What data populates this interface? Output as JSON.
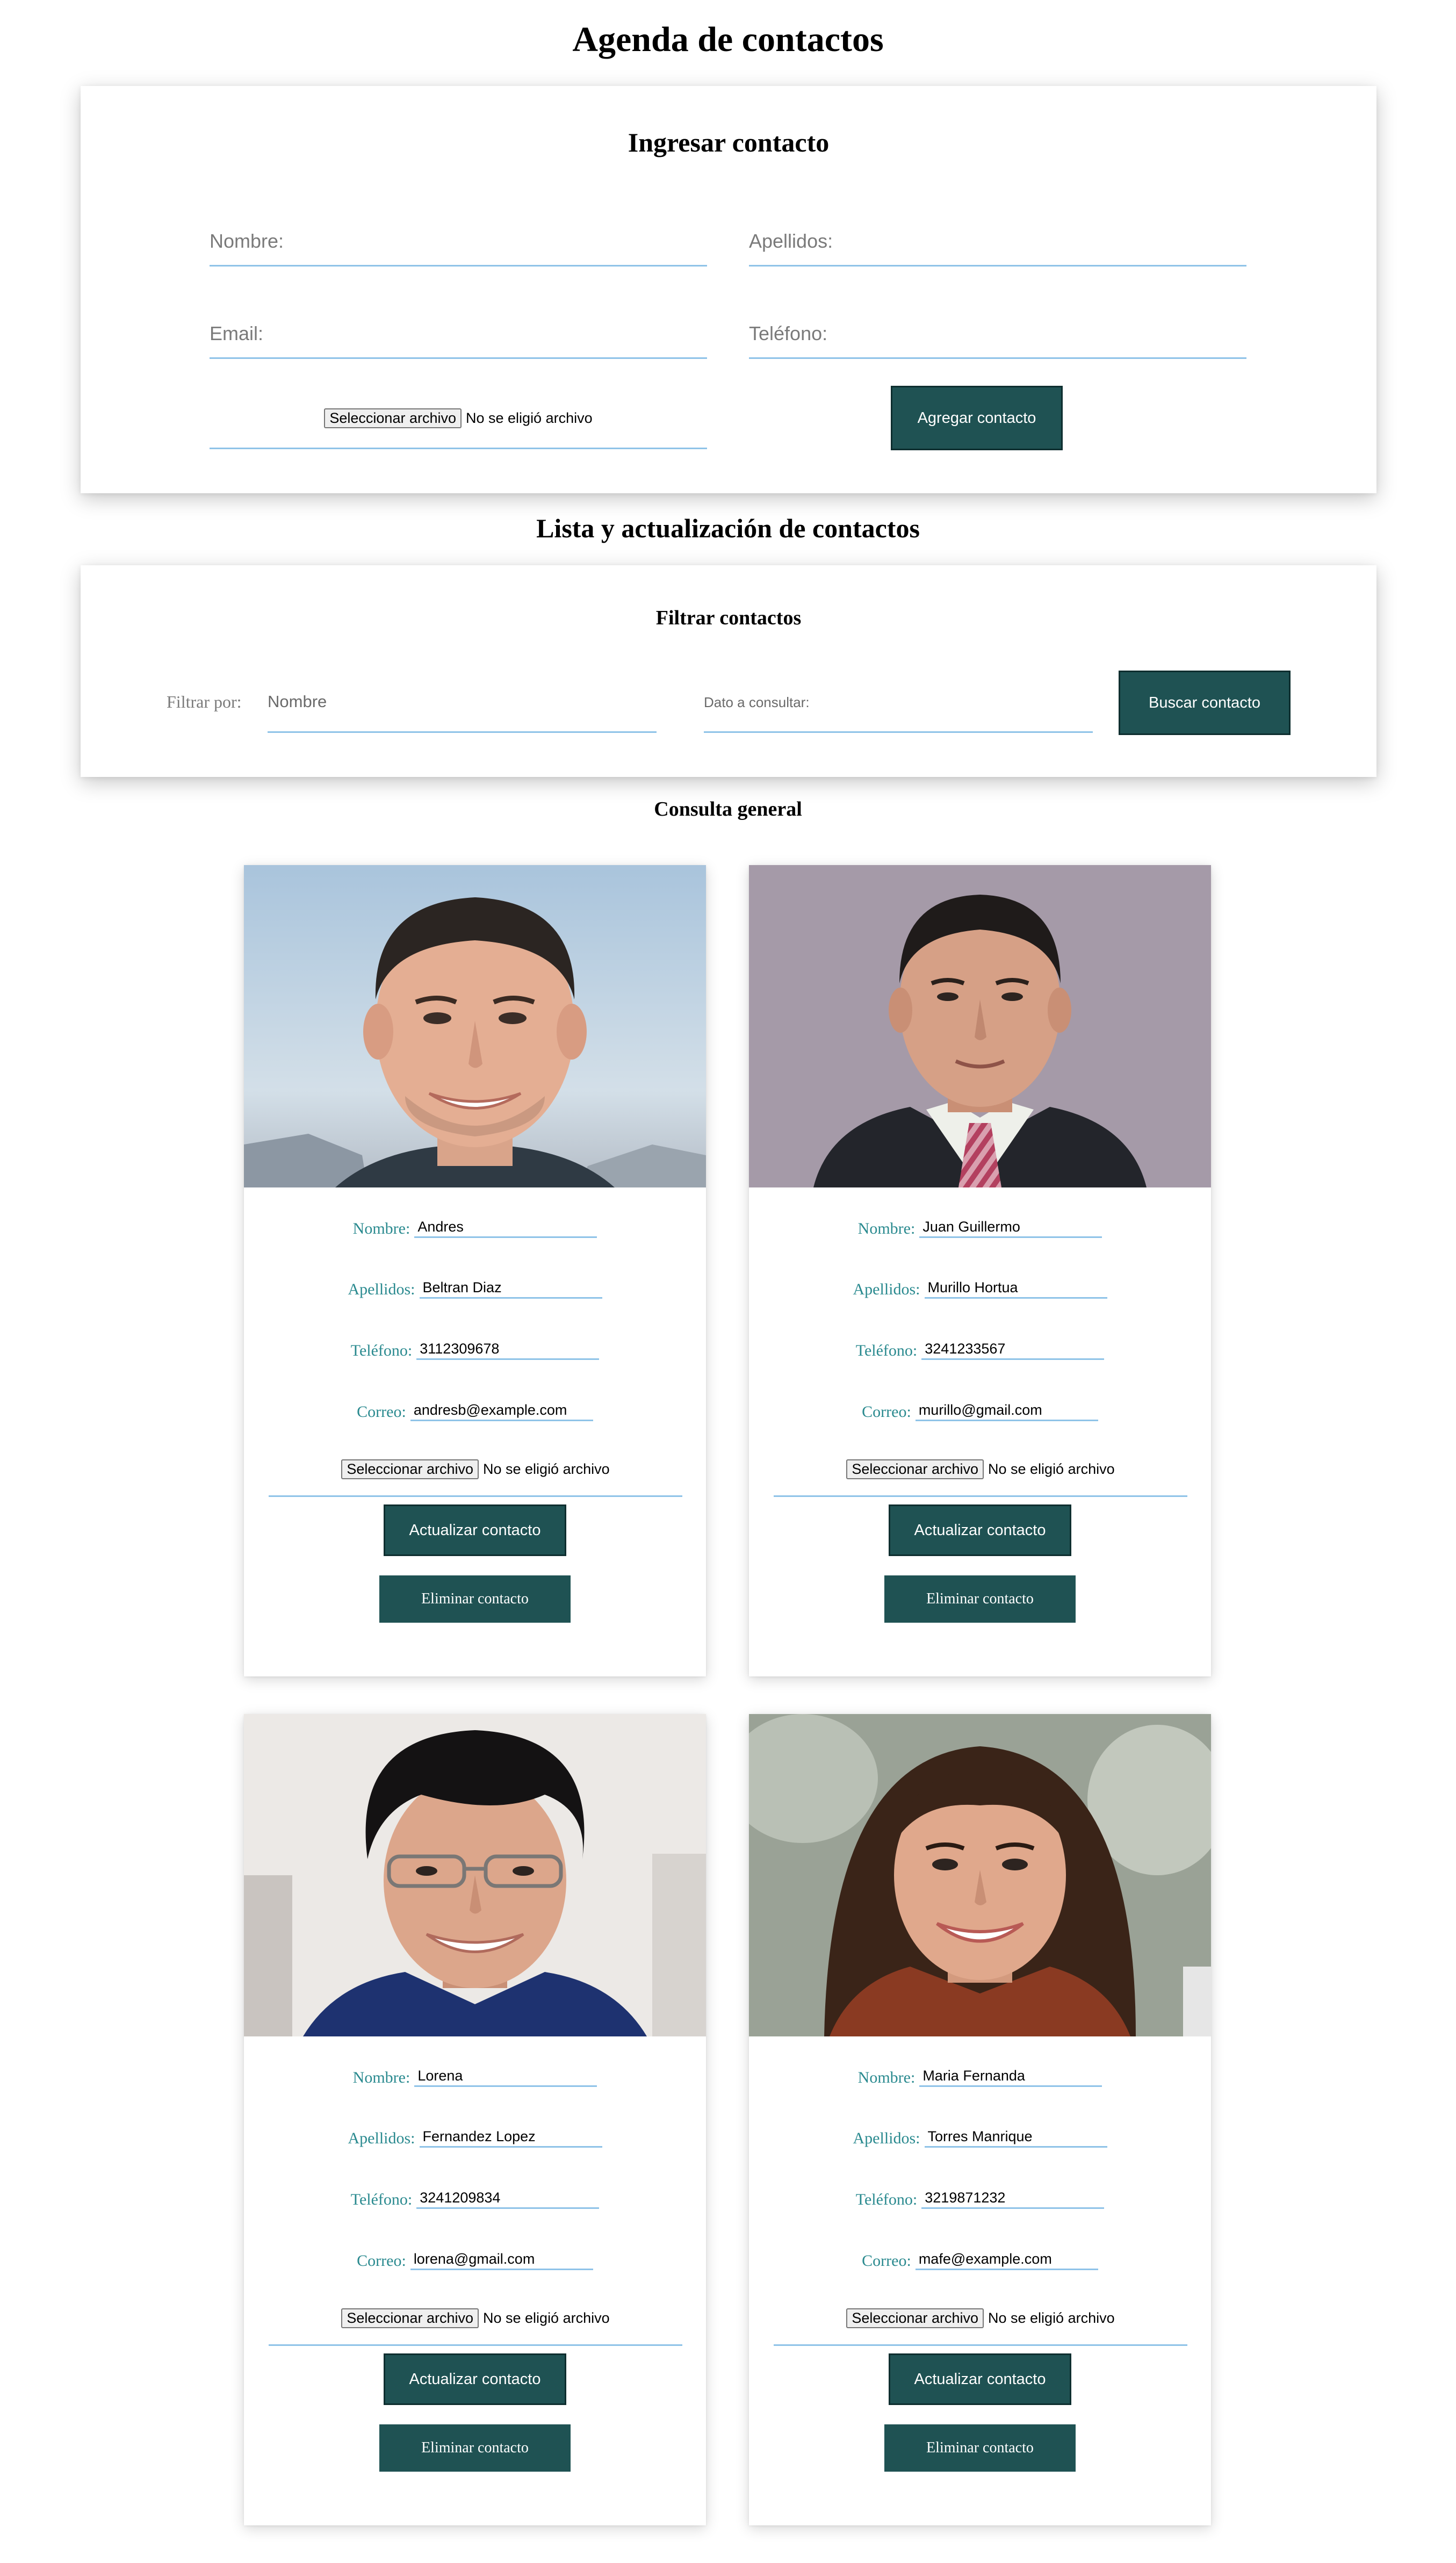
{
  "page": {
    "title": "Agenda de contactos"
  },
  "add_form": {
    "title": "Ingresar contacto",
    "nombre_placeholder": "Nombre:",
    "apellidos_placeholder": "Apellidos:",
    "email_placeholder": "Email:",
    "telefono_placeholder": "Teléfono:",
    "file_button": "Seleccionar archivo",
    "file_status": "No se eligió archivo",
    "submit_label": "Agregar contacto"
  },
  "list_section": {
    "title": "Lista y actualización de contactos"
  },
  "filter": {
    "title": "Filtrar contactos",
    "filter_by_label": "Filtrar por:",
    "selected_option": "Nombre",
    "query_placeholder": "Dato a consultar:",
    "search_label": "Buscar contacto"
  },
  "general": {
    "title": "Consulta general"
  },
  "card_labels": {
    "nombre": "Nombre:",
    "apellidos": "Apellidos:",
    "telefono": "Teléfono:",
    "correo": "Correo:",
    "file_button": "Seleccionar archivo",
    "file_status": "No se eligió archivo",
    "update": "Actualizar contacto",
    "delete": "Eliminar contacto"
  },
  "contacts": [
    {
      "nombre": "Andres",
      "apellidos": "Beltran Diaz",
      "telefono": "3112309678",
      "correo": "andresb@example.com"
    },
    {
      "nombre": "Juan Guillermo",
      "apellidos": "Murillo Hortua",
      "telefono": "3241233567",
      "correo": "murillo@gmail.com"
    },
    {
      "nombre": "Lorena",
      "apellidos": "Fernandez Lopez",
      "telefono": "3241209834",
      "correo": "lorena@gmail.com"
    },
    {
      "nombre": "Maria Fernanda",
      "apellidos": "Torres Manrique",
      "telefono": "3219871232",
      "correo": "mafe@example.com"
    }
  ],
  "colors": {
    "button_bg": "#1f5253",
    "label_teal": "#2a8a8f",
    "underline": "#8fc3e8"
  }
}
